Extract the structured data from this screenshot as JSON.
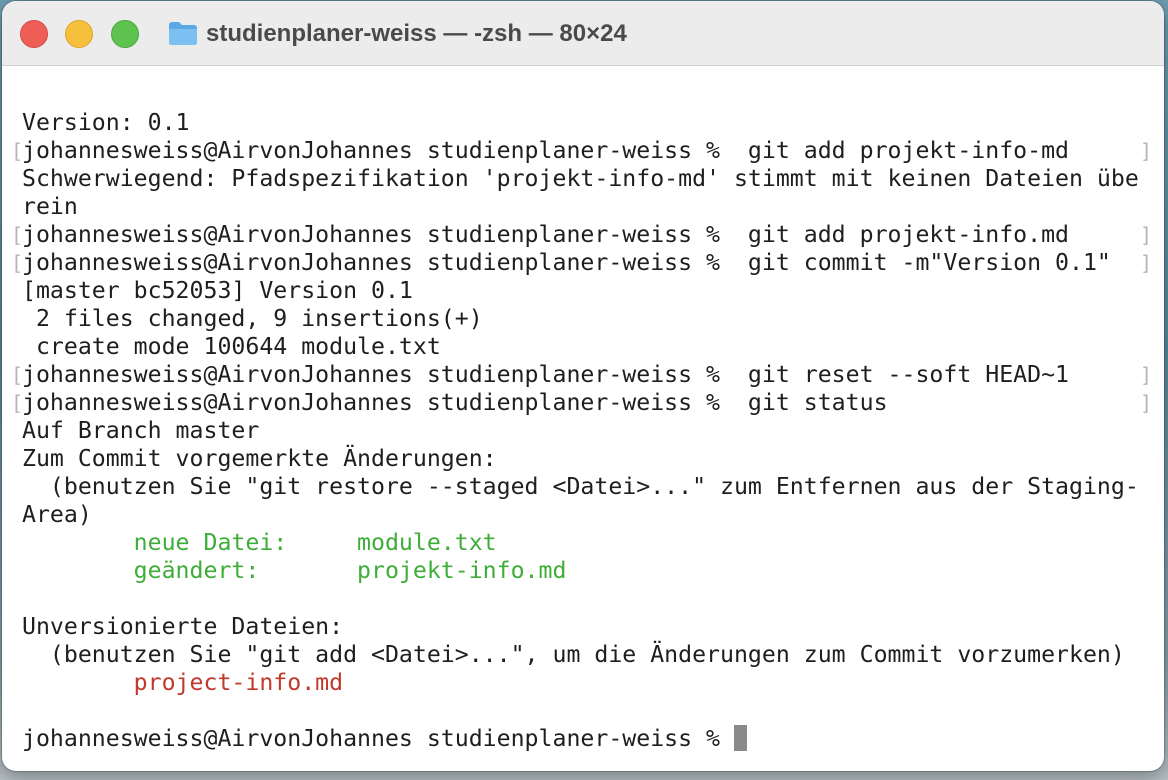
{
  "window": {
    "title": "studienplaner-weiss — -zsh — 80×24",
    "folder_icon": "folder-icon"
  },
  "terminal": {
    "lines": [
      {
        "text": "Version: 0.1",
        "kind": "output"
      },
      {
        "text": "johannesweiss@AirvonJohannes studienplaner-weiss %  git add projekt-info-md",
        "kind": "prompt"
      },
      {
        "text": "Schwerwiegend: Pfadspezifikation 'projekt-info-md' stimmt mit keinen Dateien übe",
        "kind": "output"
      },
      {
        "text": "rein",
        "kind": "output"
      },
      {
        "text": "johannesweiss@AirvonJohannes studienplaner-weiss %  git add projekt-info.md",
        "kind": "prompt"
      },
      {
        "text": "johannesweiss@AirvonJohannes studienplaner-weiss %  git commit -m\"Version 0.1\"",
        "kind": "prompt"
      },
      {
        "text": "[master bc52053] Version 0.1",
        "kind": "output"
      },
      {
        "text": " 2 files changed, 9 insertions(+)",
        "kind": "output"
      },
      {
        "text": " create mode 100644 module.txt",
        "kind": "output"
      },
      {
        "text": "johannesweiss@AirvonJohannes studienplaner-weiss %  git reset --soft HEAD~1",
        "kind": "prompt"
      },
      {
        "text": "johannesweiss@AirvonJohannes studienplaner-weiss %  git status",
        "kind": "prompt"
      },
      {
        "text": "Auf Branch master",
        "kind": "output"
      },
      {
        "text": "Zum Commit vorgemerkte Änderungen:",
        "kind": "output"
      },
      {
        "text": "  (benutzen Sie \"git restore --staged <Datei>...\" zum Entfernen aus der Staging-",
        "kind": "output"
      },
      {
        "text": "Area)",
        "kind": "output"
      },
      {
        "text": "        neue Datei:     module.txt",
        "kind": "staged"
      },
      {
        "text": "        geändert:       projekt-info.md",
        "kind": "staged"
      },
      {
        "text": "",
        "kind": "output"
      },
      {
        "text": "Unversionierte Dateien:",
        "kind": "output"
      },
      {
        "text": "  (benutzen Sie \"git add <Datei>...\", um die Änderungen zum Commit vorzumerken)",
        "kind": "output"
      },
      {
        "text": "        project-info.md",
        "kind": "untracked"
      },
      {
        "text": "",
        "kind": "output"
      }
    ],
    "current_prompt": "johannesweiss@AirvonJohannes studienplaner-weiss % ",
    "colors": {
      "staged": "#3fae38",
      "untracked": "#c0392b",
      "text": "#1e1e1e"
    }
  }
}
